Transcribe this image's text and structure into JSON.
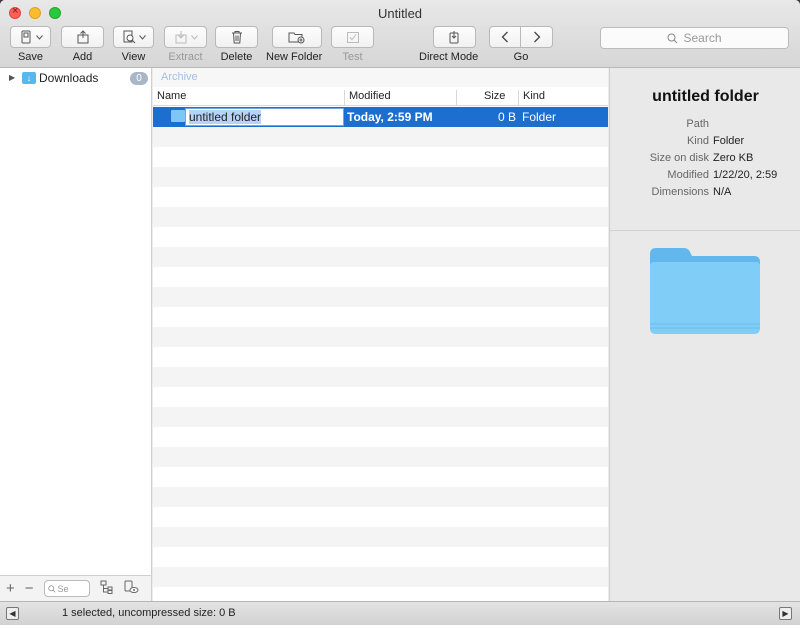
{
  "window": {
    "title": "Untitled"
  },
  "toolbar": {
    "save": "Save",
    "add": "Add",
    "view": "View",
    "extract": "Extract",
    "delete": "Delete",
    "new_folder": "New Folder",
    "test": "Test",
    "direct_mode": "Direct Mode",
    "go": "Go",
    "search_placeholder": "Search"
  },
  "sidebar": {
    "items": [
      {
        "label": "Downloads",
        "badge": "0"
      }
    ],
    "mini_search_placeholder": "Se"
  },
  "breadcrumb": {
    "label": "Archive"
  },
  "table": {
    "columns": [
      "Name",
      "Modified",
      "Size",
      "Kind"
    ],
    "rows": [
      {
        "name": "untitled folder",
        "modified": "Today, 2:59 PM",
        "size": "0 B",
        "kind": "Folder",
        "selected": true
      }
    ]
  },
  "info": {
    "title": "untitled folder",
    "fields": [
      {
        "key": "Path",
        "value": ""
      },
      {
        "key": "Kind",
        "value": "Folder"
      },
      {
        "key": "Size on disk",
        "value": "Zero KB"
      },
      {
        "key": "Modified",
        "value": "1/22/20, 2:59"
      },
      {
        "key": "Dimensions",
        "value": "N/A"
      }
    ]
  },
  "status": {
    "text": "1 selected, uncompressed size: 0 B"
  },
  "colors": {
    "selection": "#1d6fcf",
    "folder": "#7cc7f5",
    "accent": "#56b8ec"
  }
}
